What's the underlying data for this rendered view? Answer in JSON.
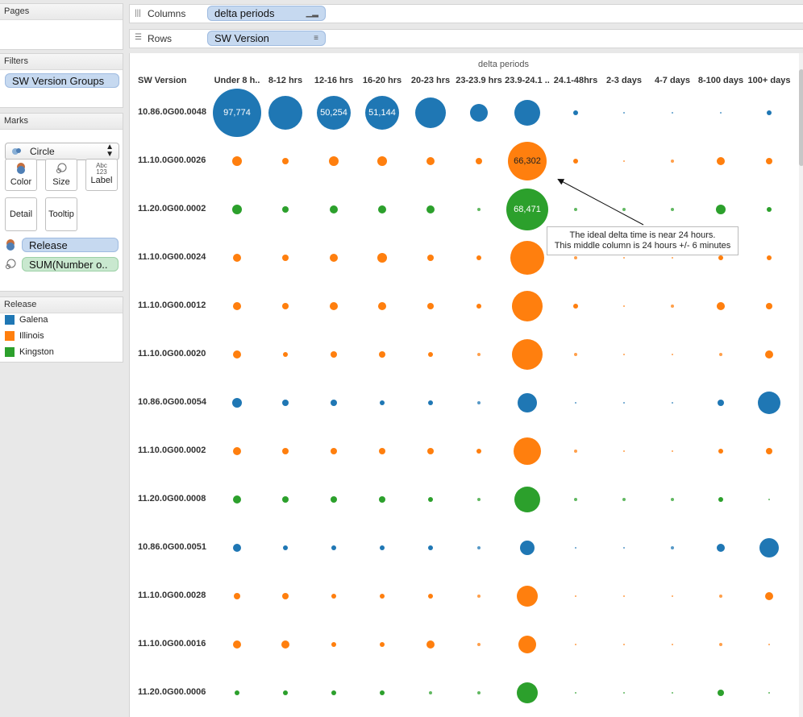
{
  "left_panel": {
    "pages": {
      "title": "Pages"
    },
    "filters": {
      "title": "Filters",
      "items": [
        "SW Version Groups"
      ]
    },
    "marks": {
      "title": "Marks",
      "mark_type": "Circle",
      "buttons": {
        "color": "Color",
        "size": "Size",
        "label": "Label",
        "label_icon": "Abc\n123",
        "detail": "Detail",
        "tooltip": "Tooltip"
      },
      "fields": {
        "color_field": "Release",
        "size_field": "SUM(Number o.."
      }
    },
    "legend": {
      "title": "Release",
      "items": [
        {
          "label": "Galena",
          "color": "#1f77b4"
        },
        {
          "label": "Illinois",
          "color": "#ff7f0e"
        },
        {
          "label": "Kingston",
          "color": "#2ca02c"
        }
      ]
    }
  },
  "shelves": {
    "columns": {
      "label": "Columns",
      "pill": "delta periods"
    },
    "rows": {
      "label": "Rows",
      "pill": "SW Version"
    }
  },
  "view": {
    "column_group_title": "delta periods",
    "row_header_title": "SW Version",
    "columns": [
      "Under 8 h..",
      "8-12 hrs",
      "12-16 hrs",
      "16-20 hrs",
      "20-23 hrs",
      "23-23.9 hrs",
      "23.9-24.1 ..",
      "24.1-48hrs",
      "2-3 days",
      "4-7 days",
      "8-100 days",
      "100+ days"
    ],
    "rows": [
      {
        "version": "10.86.0G00.0048",
        "release": "Galena"
      },
      {
        "version": "11.10.0G00.0026",
        "release": "Illinois"
      },
      {
        "version": "11.20.0G00.0002",
        "release": "Kingston"
      },
      {
        "version": "11.10.0G00.0024",
        "release": "Illinois"
      },
      {
        "version": "11.10.0G00.0012",
        "release": "Illinois"
      },
      {
        "version": "11.10.0G00.0020",
        "release": "Illinois"
      },
      {
        "version": "10.86.0G00.0054",
        "release": "Galena"
      },
      {
        "version": "11.10.0G00.0002",
        "release": "Illinois"
      },
      {
        "version": "11.20.0G00.0008",
        "release": "Kingston"
      },
      {
        "version": "10.86.0G00.0051",
        "release": "Galena"
      },
      {
        "version": "11.10.0G00.0028",
        "release": "Illinois"
      },
      {
        "version": "11.10.0G00.0016",
        "release": "Illinois"
      },
      {
        "version": "11.20.0G00.0006",
        "release": "Kingston"
      }
    ],
    "labels": [
      {
        "row": 0,
        "col": 0,
        "text": "97,774"
      },
      {
        "row": 0,
        "col": 2,
        "text": "50,254"
      },
      {
        "row": 0,
        "col": 3,
        "text": "51,144"
      },
      {
        "row": 1,
        "col": 6,
        "text": "66,302"
      },
      {
        "row": 2,
        "col": 6,
        "text": "68,471"
      }
    ],
    "annotation": {
      "line1": "The ideal delta time is near 24 hours.",
      "line2": "This middle column is 24 hours +/- 6 minutes"
    }
  }
}
